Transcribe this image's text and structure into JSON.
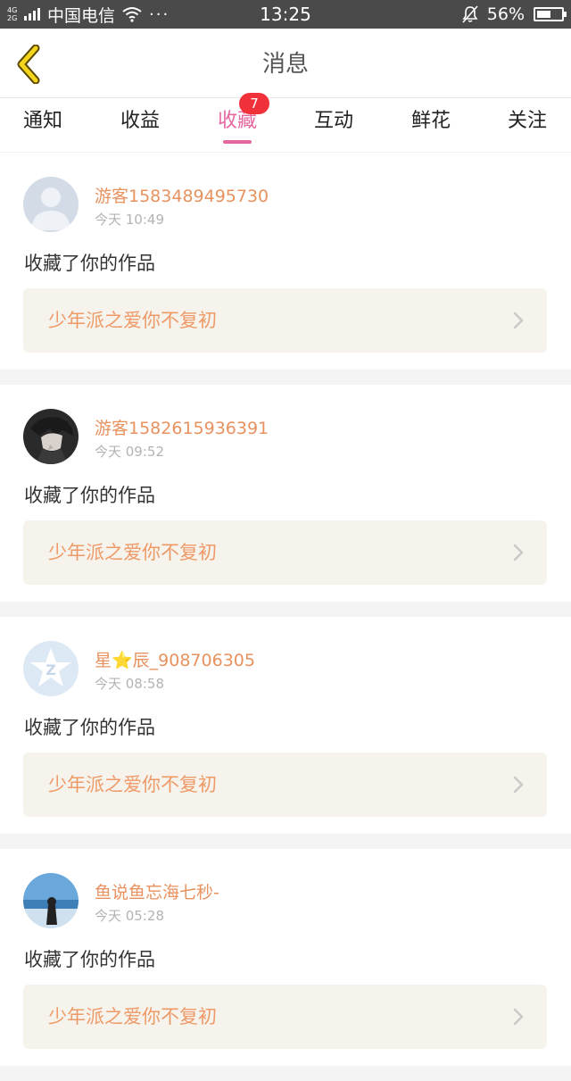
{
  "status_bar": {
    "network_top": "4G",
    "network_bottom": "2G",
    "carrier": "中国电信",
    "more": "···",
    "time": "13:25",
    "battery_percent": "56%",
    "battery_level": 0.56
  },
  "nav": {
    "title": "消息"
  },
  "tabs": [
    {
      "label": "通知"
    },
    {
      "label": "收益"
    },
    {
      "label": "收藏",
      "badge": "7",
      "active": true
    },
    {
      "label": "互动"
    },
    {
      "label": "鲜花"
    },
    {
      "label": "关注"
    }
  ],
  "colors": {
    "accent": "#e5679f",
    "name": "#e8925f",
    "badge": "#f0313a"
  },
  "feed": [
    {
      "user": "游客1583489495730",
      "time": "今天 10:49",
      "action": "收藏了你的作品",
      "work": "少年派之爱你不复初",
      "avatar": "default-avatar"
    },
    {
      "user": "游客1582615936391",
      "time": "今天 09:52",
      "action": "收藏了你的作品",
      "work": "少年派之爱你不复初",
      "avatar": "anime-avatar"
    },
    {
      "user": "星⭐辰_908706305",
      "time": "今天 08:58",
      "action": "收藏了你的作品",
      "work": "少年派之爱你不复初",
      "avatar": "qq-avatar"
    },
    {
      "user": "鱼说鱼忘海七秒-",
      "time": "今天 05:28",
      "action": "收藏了你的作品",
      "work": "少年派之爱你不复初",
      "avatar": "beach-avatar"
    }
  ]
}
